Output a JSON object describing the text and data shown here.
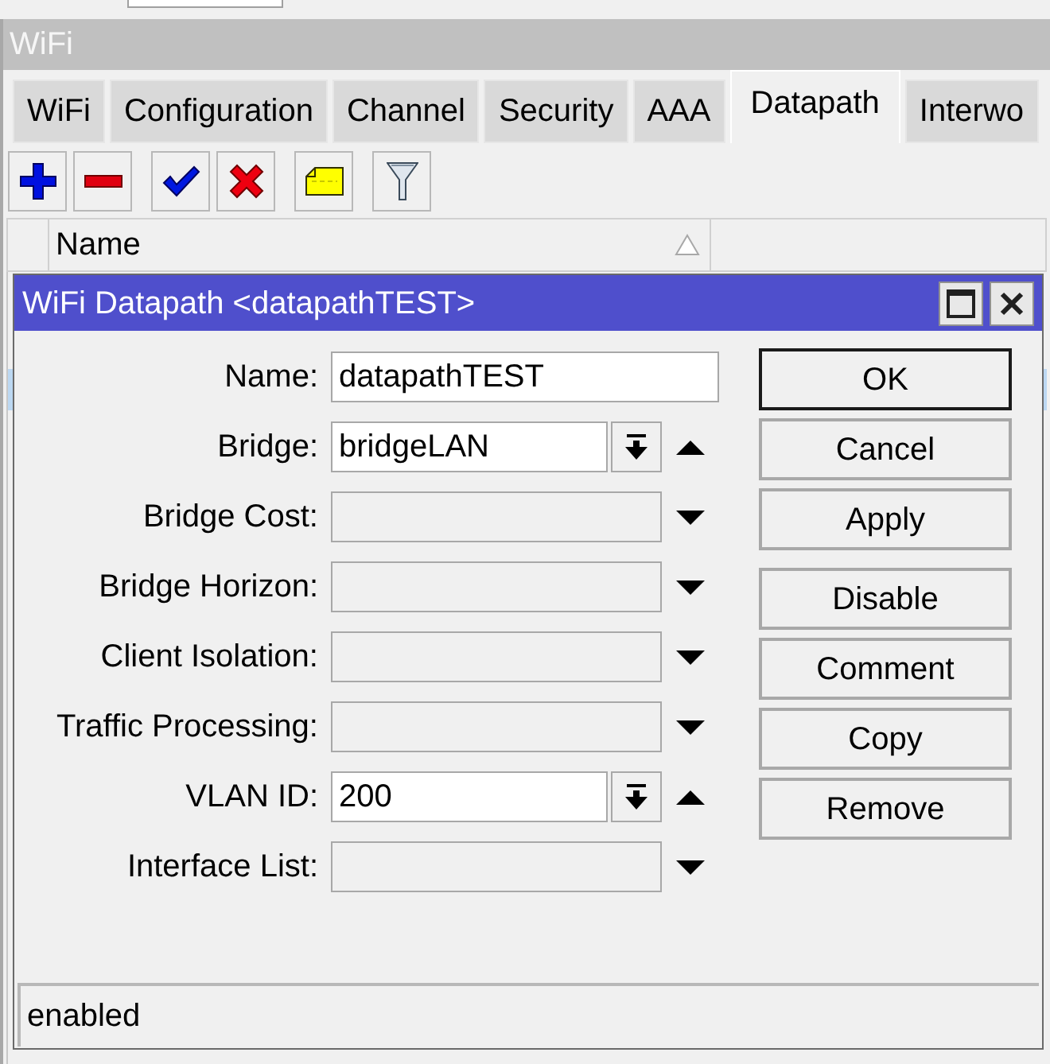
{
  "window": {
    "title": "WiFi"
  },
  "tabs": [
    {
      "label": "WiFi",
      "selected": false
    },
    {
      "label": "Configuration",
      "selected": false
    },
    {
      "label": "Channel",
      "selected": false
    },
    {
      "label": "Security",
      "selected": false
    },
    {
      "label": "AAA",
      "selected": false
    },
    {
      "label": "Datapath",
      "selected": true
    },
    {
      "label": "Interwo",
      "selected": false
    }
  ],
  "toolbar_groups": [
    [
      {
        "kind": "add"
      },
      {
        "kind": "remove"
      }
    ],
    [
      {
        "kind": "enable"
      },
      {
        "kind": "disable"
      }
    ],
    [
      {
        "kind": "comment"
      }
    ],
    [
      {
        "kind": "filter"
      }
    ]
  ],
  "table": {
    "columns": [
      {
        "label": "Name",
        "sorted": true
      }
    ],
    "rows": [
      {
        "selected": true
      }
    ]
  },
  "dialog": {
    "title": "WiFi Datapath <datapathTEST>",
    "fields": [
      {
        "kind": "text",
        "label": "Name:",
        "value": "datapathTEST"
      },
      {
        "kind": "option",
        "label": "Bridge:",
        "value": "bridgeLAN",
        "set": true
      },
      {
        "kind": "option",
        "label": "Bridge Cost:",
        "set": false
      },
      {
        "kind": "option",
        "label": "Bridge Horizon:",
        "set": false
      },
      {
        "kind": "option",
        "label": "Client Isolation:",
        "set": false
      },
      {
        "kind": "option",
        "label": "Traffic Processing:",
        "set": false
      },
      {
        "kind": "option",
        "label": "VLAN ID:",
        "value": "200",
        "set": true
      },
      {
        "kind": "option",
        "label": "Interface List:",
        "set": false
      }
    ],
    "button_groups": [
      [
        {
          "label": "OK",
          "default": true
        },
        {
          "label": "Cancel",
          "default": false
        },
        {
          "label": "Apply",
          "default": false
        }
      ],
      [
        {
          "label": "Disable",
          "default": false
        },
        {
          "label": "Comment",
          "default": false
        },
        {
          "label": "Copy",
          "default": false
        },
        {
          "label": "Remove",
          "default": false
        }
      ]
    ],
    "status_bar": {
      "text": "enabled"
    }
  }
}
